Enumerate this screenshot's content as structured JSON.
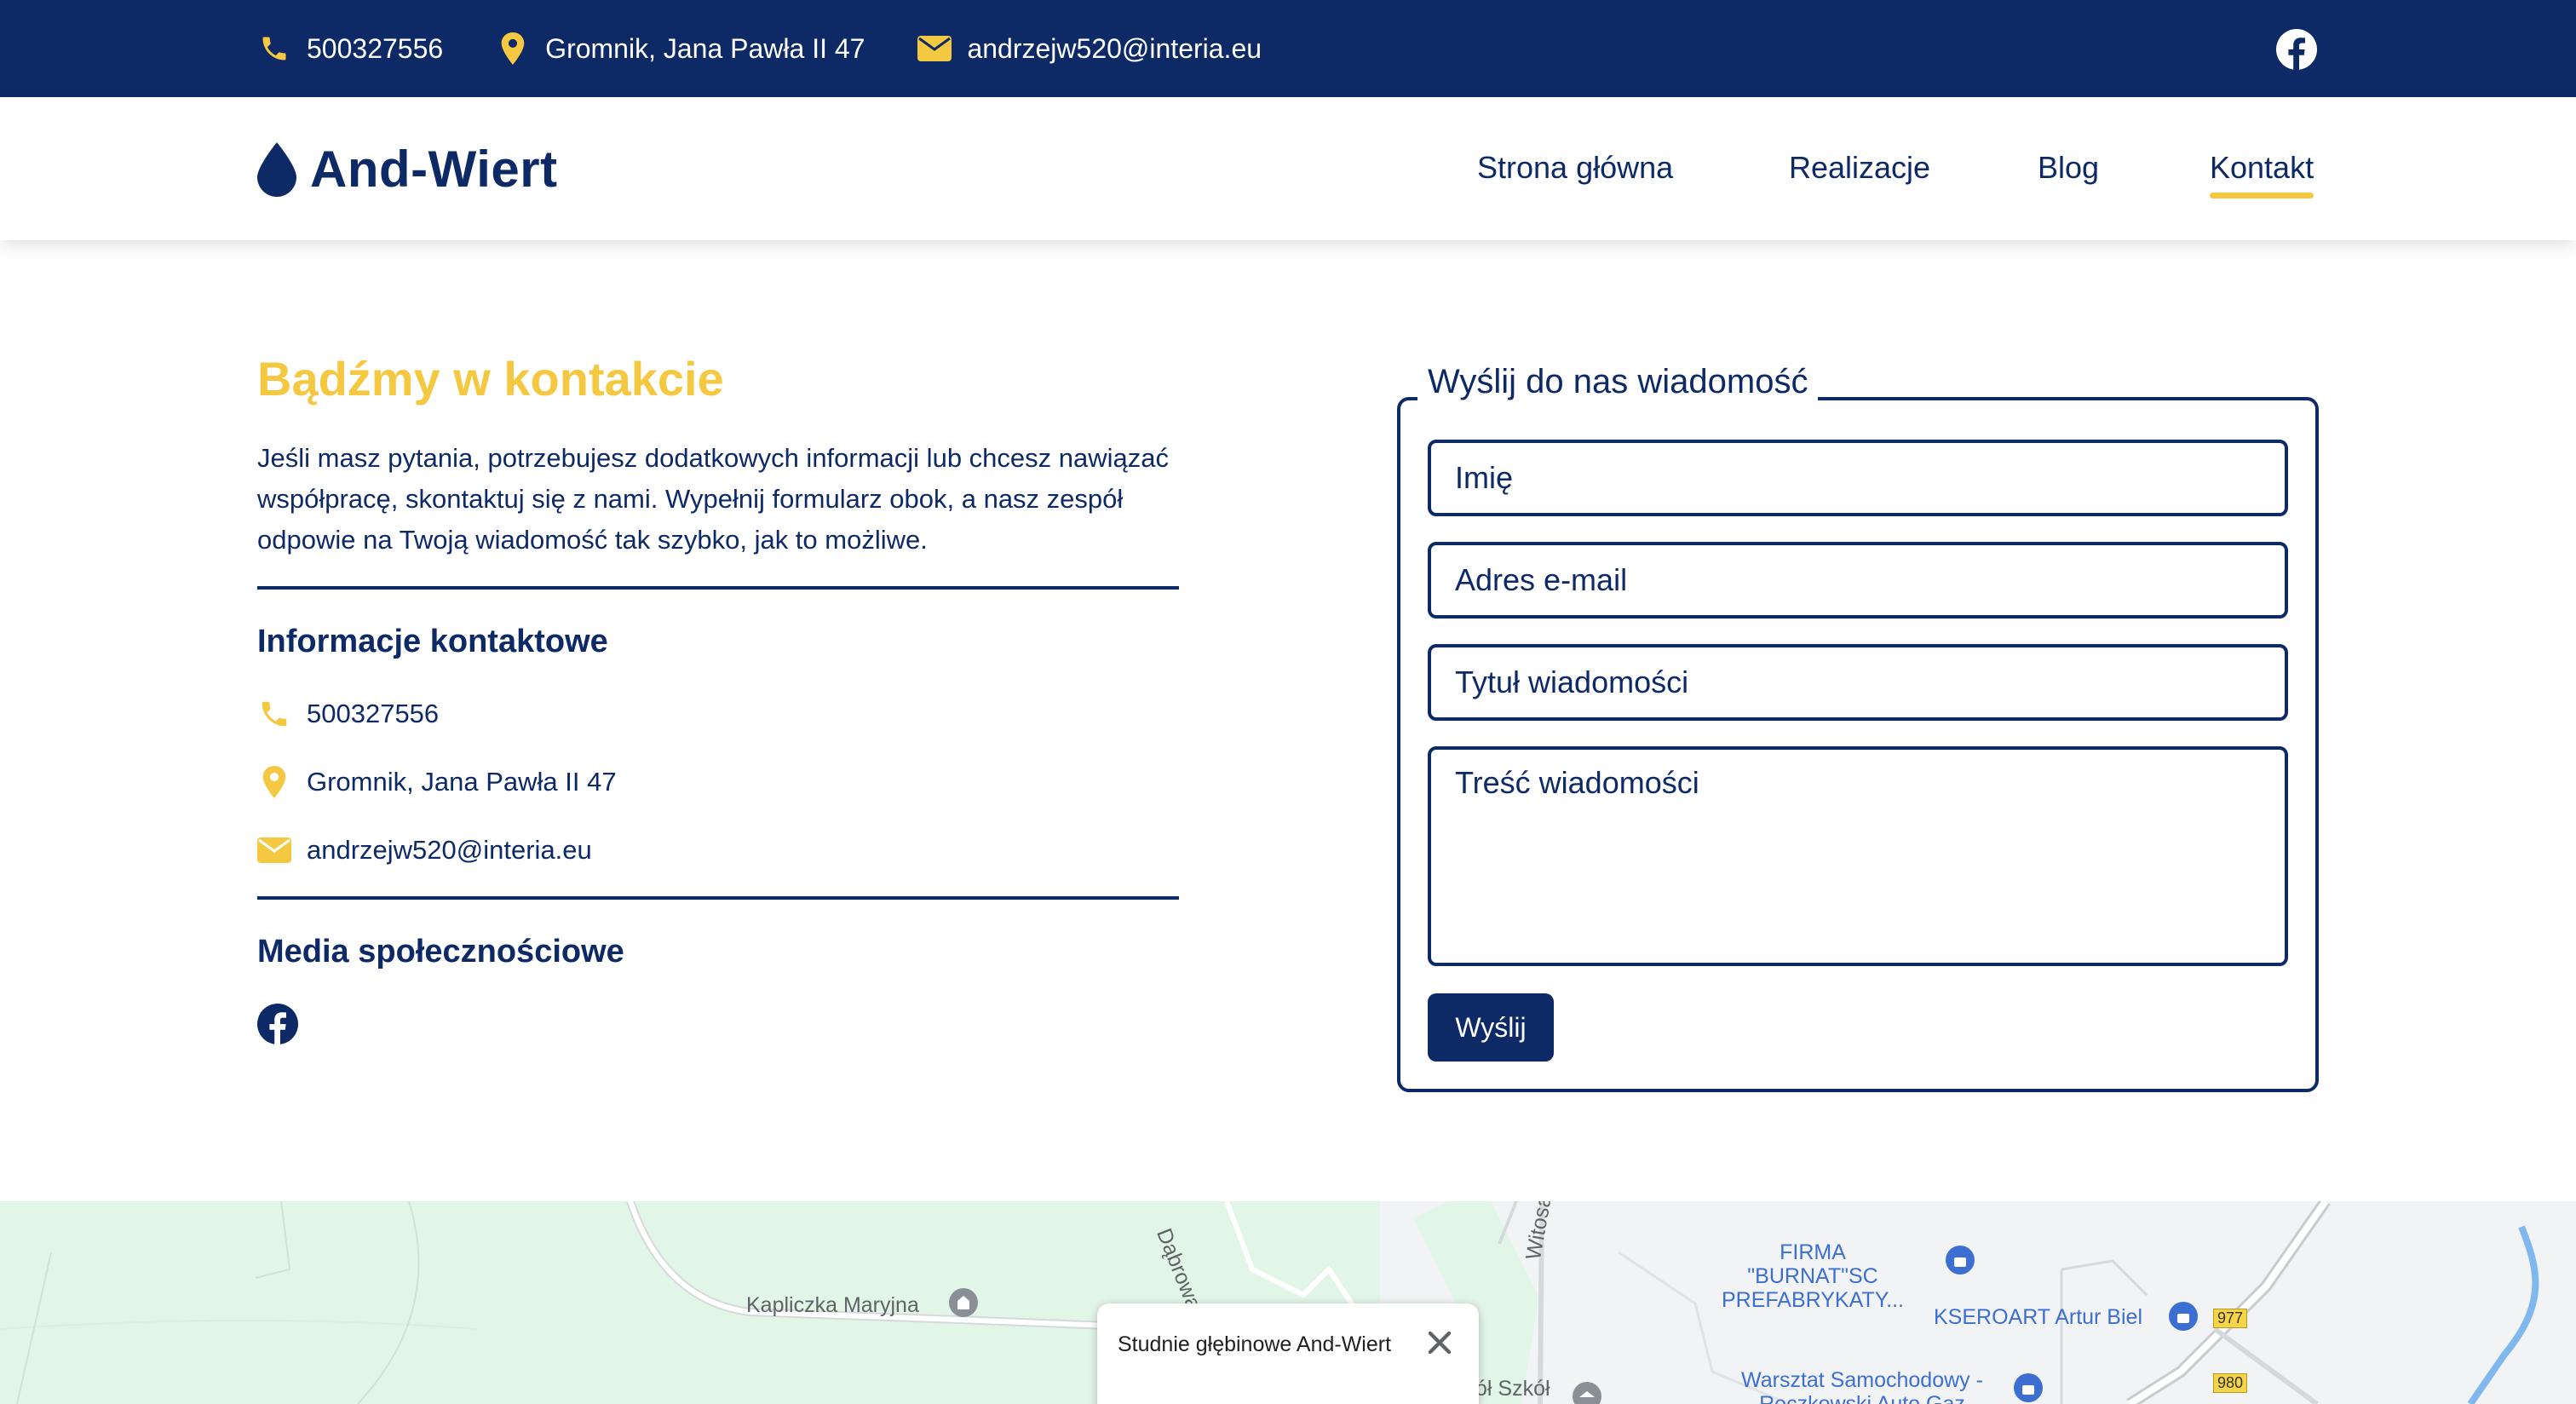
{
  "topbar": {
    "phone": "500327556",
    "address": "Gromnik, Jana Pawła II 47",
    "email": "andrzejw520@interia.eu"
  },
  "header": {
    "logo_text": "And-Wiert",
    "nav": [
      {
        "label": "Strona główna",
        "active": false
      },
      {
        "label": "Realizacje",
        "active": false
      },
      {
        "label": "Blog",
        "active": false
      },
      {
        "label": "Kontakt",
        "active": true
      }
    ]
  },
  "contact": {
    "title": "Bądźmy w kontakcie",
    "intro": "Jeśli masz pytania, potrzebujesz dodatkowych informacji lub chcesz nawiązać współpracę, skontaktuj się z nami. Wypełnij formularz obok, a nasz zespół odpowie na Twoją wiadomość tak szybko, jak to możliwe.",
    "info_heading": "Informacje kontaktowe",
    "phone": "500327556",
    "address": "Gromnik, Jana Pawła II 47",
    "email": "andrzejw520@interia.eu",
    "social_heading": "Media społecznościowe"
  },
  "form": {
    "legend": "Wyślij do nas wiadomość",
    "name_placeholder": "Imię",
    "email_placeholder": "Adres e-mail",
    "subject_placeholder": "Tytuł wiadomości",
    "message_placeholder": "Treść wiadomości",
    "submit_label": "Wyślij"
  },
  "map": {
    "labels": {
      "dabrowa": "Dąbrowa",
      "witosa": "Witosa",
      "kapliczka": "Kapliczka Maryjna",
      "szkol": "ół Szkół",
      "burnat": "FIRMA \"BURNAT\"SC PREFABRYKATY...",
      "kseroart": "KSEROART Artur Biel",
      "warsztat": "Warsztat Samochodowy - Reczkowski Auto Gaz",
      "road_977": "977",
      "road_980": "980"
    },
    "popup_title": "Studnie głębinowe And-Wiert"
  },
  "colors": {
    "navy": "#0d2a66",
    "yellow": "#f5c842"
  }
}
